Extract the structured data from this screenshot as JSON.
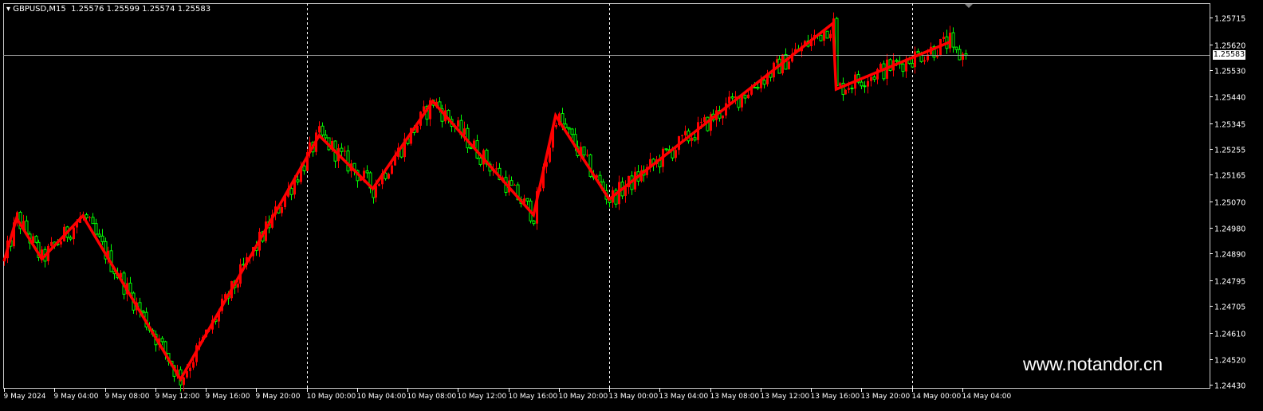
{
  "header": {
    "symbol": "GBPUSD,M15",
    "ohlc": "1.25576 1.25599 1.25574 1.25583"
  },
  "watermark": "www.notandor.cn",
  "current_price": "1.25583",
  "colors": {
    "background": "#000000",
    "up": "#ff0000",
    "down": "#00ff00",
    "zigzag": "#ff0000",
    "grid": "#ffffff"
  },
  "chart_data": {
    "type": "candlestick",
    "title": "GBPUSD,M15",
    "bar_minutes": 15,
    "bars": 306,
    "ylim": [
      1.2443,
      1.25715
    ],
    "y_ticks": [
      "1.25715",
      "1.25620",
      "1.25530",
      "1.25440",
      "1.25345",
      "1.25255",
      "1.25165",
      "1.25070",
      "1.24980",
      "1.24890",
      "1.24795",
      "1.24705",
      "1.24610",
      "1.24520",
      "1.24430"
    ],
    "x_ticks": [
      "9 May 2024",
      "9 May 04:00",
      "9 May 08:00",
      "9 May 12:00",
      "9 May 16:00",
      "9 May 20:00",
      "10 May 00:00",
      "10 May 04:00",
      "10 May 08:00",
      "10 May 12:00",
      "10 May 16:00",
      "10 May 20:00",
      "13 May 00:00",
      "13 May 04:00",
      "13 May 08:00",
      "13 May 12:00",
      "13 May 16:00",
      "13 May 20:00",
      "14 May 00:00",
      "14 May 04:00"
    ],
    "day_separators_at_tick": [
      6,
      12,
      18
    ],
    "zigzag": [
      [
        0,
        1.24862
      ],
      [
        4,
        1.25013
      ],
      [
        12,
        1.2487
      ],
      [
        25,
        1.25021
      ],
      [
        56,
        1.24449
      ],
      [
        100,
        1.25302
      ],
      [
        117,
        1.25116
      ],
      [
        136,
        1.25422
      ],
      [
        168,
        1.25024
      ],
      [
        175,
        1.25372
      ],
      [
        192,
        1.25079
      ],
      [
        263,
        1.25695
      ],
      [
        264,
        1.25464
      ],
      [
        300,
        1.25629
      ]
    ],
    "last_close": 1.25583
  }
}
